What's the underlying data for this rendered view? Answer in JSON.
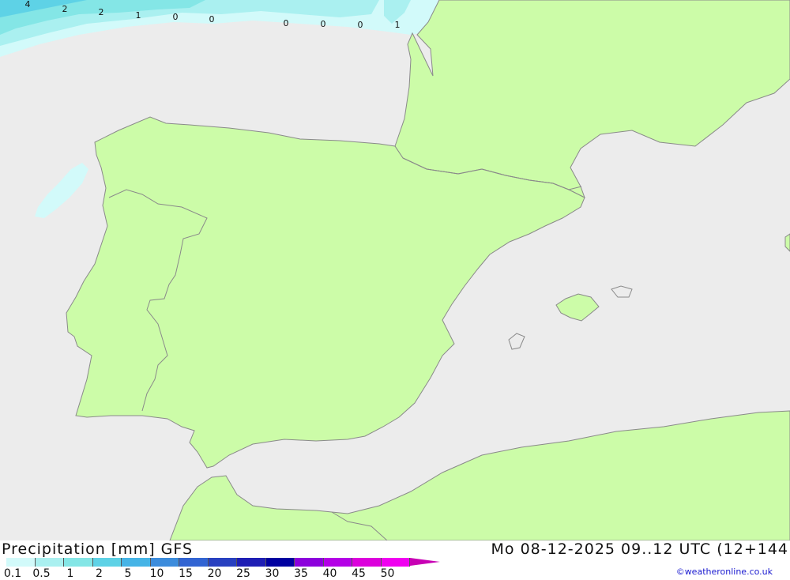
{
  "map": {
    "colors": {
      "sea": "#ececec",
      "land": "#ccfca8",
      "border": "#8a8a8a"
    },
    "precip_labels": [
      "4",
      "2",
      "2",
      "1",
      "0",
      "0",
      "0",
      "0",
      "0",
      "1"
    ]
  },
  "footer": {
    "title": "Precipitation [mm] GFS",
    "datetime": "Mo 08-12-2025 09..12 UTC (12+144",
    "credit": "©weatheronline.co.uk",
    "legend": {
      "colors": [
        "#d2fafa",
        "#aaf0f0",
        "#84e6e6",
        "#5ed2e6",
        "#46b4e6",
        "#3c8cdc",
        "#3264d2",
        "#2840c0",
        "#1e1eb4",
        "#0000a0",
        "#8c00dc",
        "#b400e6",
        "#dc00dc",
        "#f000f0",
        "#c800b4"
      ],
      "tick_labels": [
        "0.1",
        "0.5",
        "1",
        "2",
        "5",
        "10",
        "15",
        "20",
        "25",
        "30",
        "35",
        "40",
        "45",
        "50"
      ]
    }
  }
}
